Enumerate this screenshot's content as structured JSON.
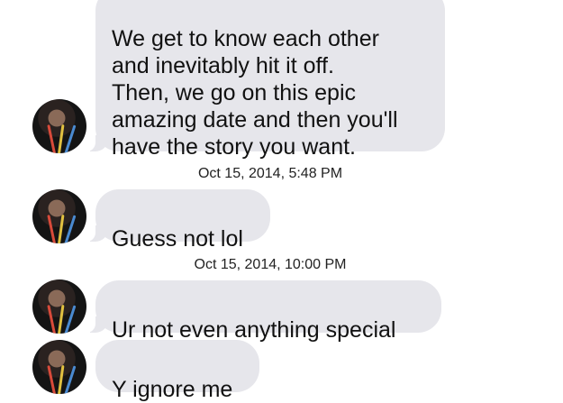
{
  "messages": [
    {
      "text": "We get to know each other\nand inevitably hit it off.\nThen, we go on this epic\namazing date and then you'll\nhave the story you want."
    },
    {
      "text": "Guess not lol"
    },
    {
      "text": "Ur not even anything special"
    },
    {
      "text": "Y ignore me"
    }
  ],
  "timestamps": [
    "Oct 15, 2014, 5:48 PM",
    "Oct 15, 2014, 10:00 PM"
  ],
  "colors": {
    "bubble": "#e6e6eb",
    "text": "#111111",
    "background": "#ffffff"
  }
}
